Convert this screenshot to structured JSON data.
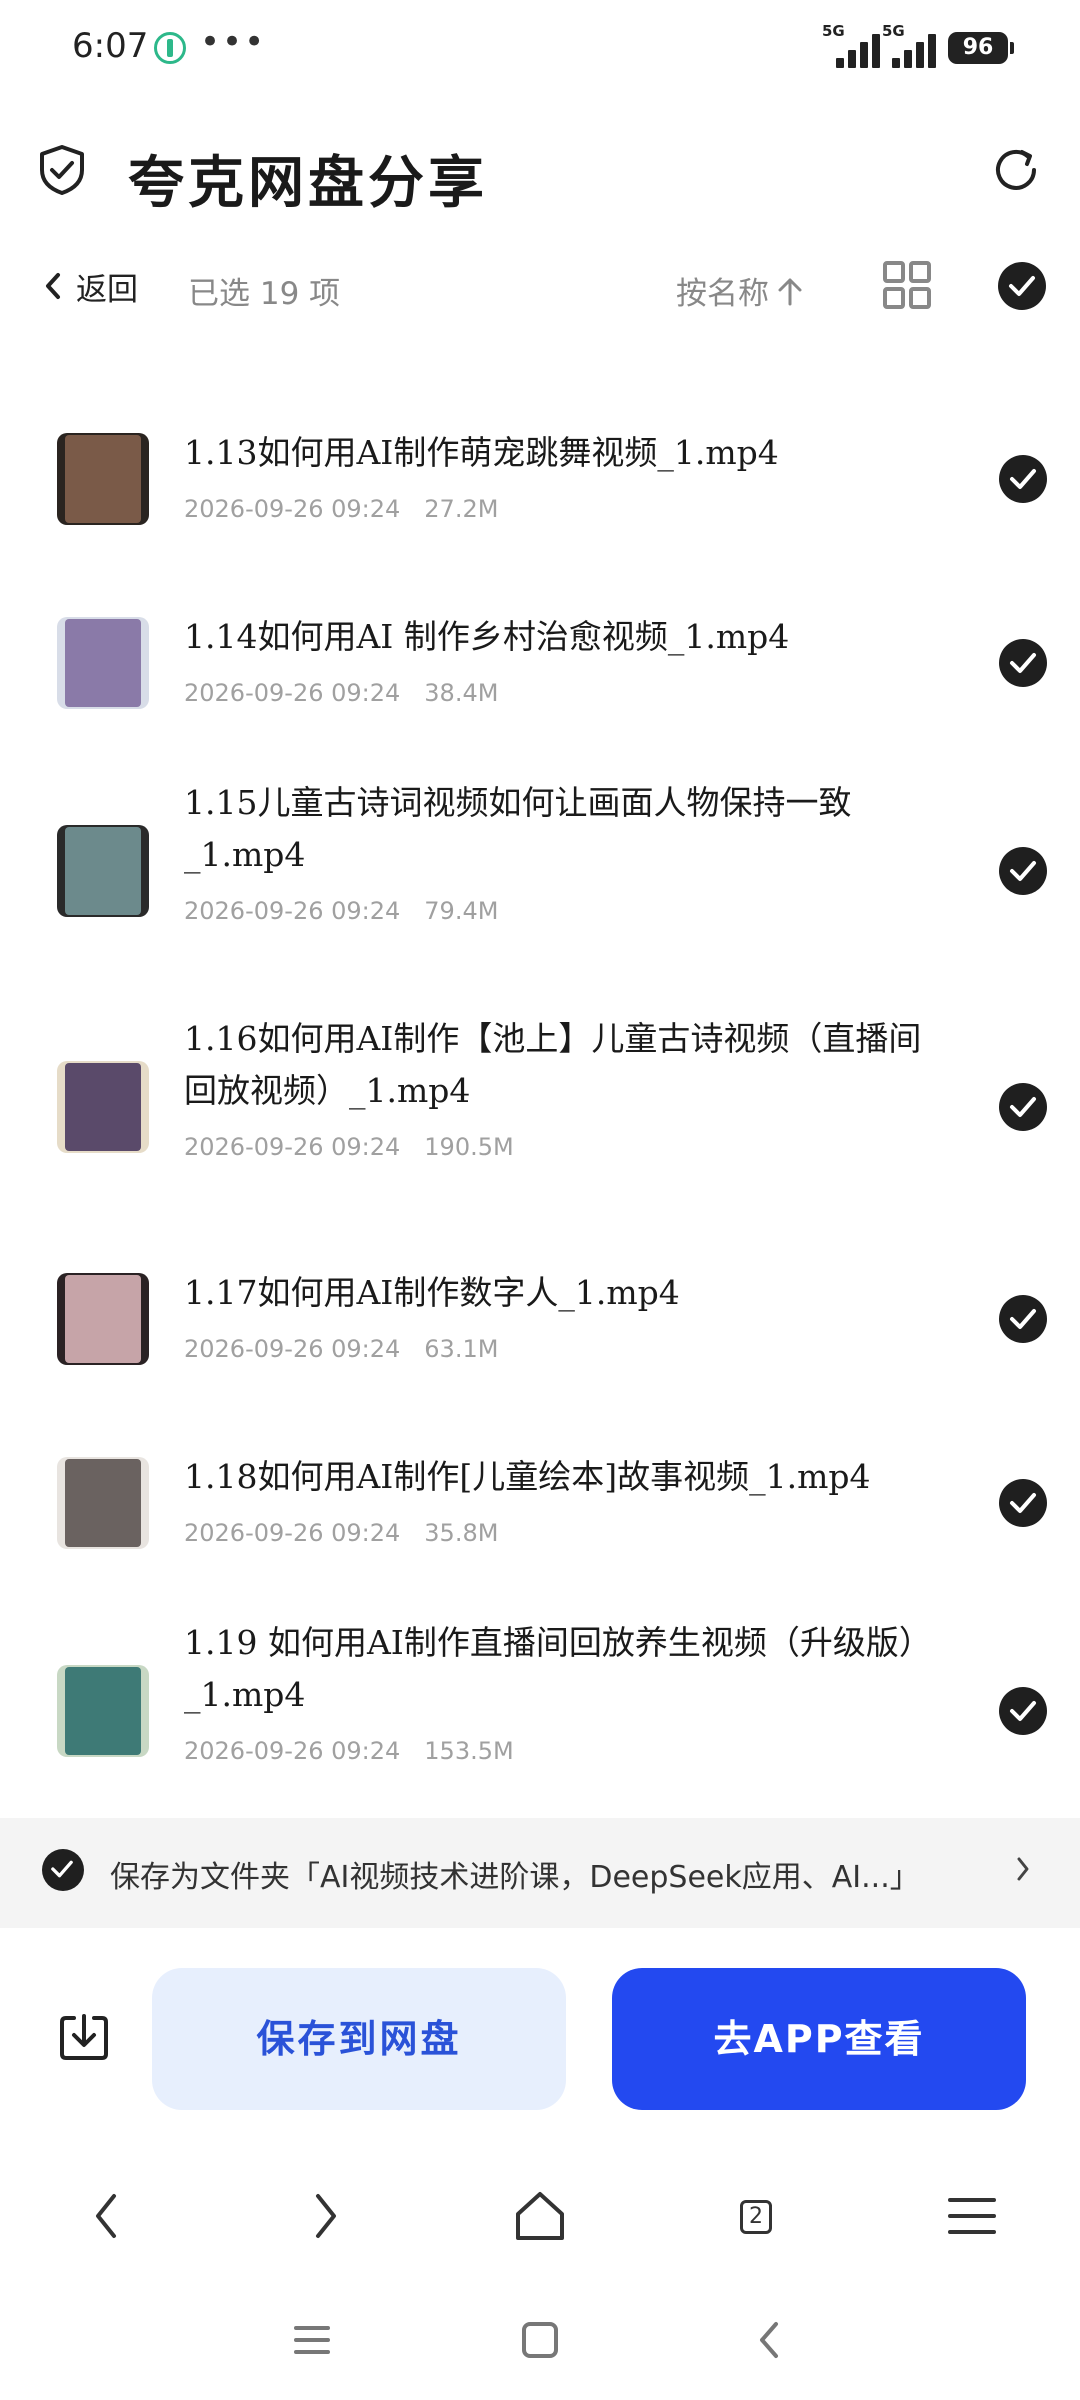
{
  "status": {
    "time": "6:07",
    "dots": "•••",
    "network_1": "5G",
    "network_2": "5G",
    "battery": "96"
  },
  "header": {
    "title": "夸克网盘分享"
  },
  "toolbar": {
    "back": "返回",
    "selected": "已选 19 项",
    "sort": "按名称"
  },
  "files": [
    {
      "name": "1.13如何用AI制作萌宠跳舞视频_1.mp4",
      "date": "2026-09-26 09:24",
      "size": "27.2M",
      "thumb": "#7a5a48"
    },
    {
      "name": "1.14如何用AI 制作乡村治愈视频_1.mp4",
      "date": "2026-09-26 09:24",
      "size": "38.4M",
      "thumb": "#8a7aa8"
    },
    {
      "name": "1.15儿童古诗词视频如何让画面人物保持一致_1.mp4",
      "date": "2026-09-26 09:24",
      "size": "79.4M",
      "thumb": "#6c8a8c"
    },
    {
      "name": "1.16如何用AI制作【池上】儿童古诗视频（直播间回放视频）_1.mp4",
      "date": "2026-09-26 09:24",
      "size": "190.5M",
      "thumb": "#5a4a6a"
    },
    {
      "name": "1.17如何用AI制作数字人_1.mp4",
      "date": "2026-09-26 09:24",
      "size": "63.1M",
      "thumb": "#c6a4a8"
    },
    {
      "name": "1.18如何用AI制作[儿童绘本]故事视频_1.mp4",
      "date": "2026-09-26 09:24",
      "size": "35.8M",
      "thumb": "#6a6260"
    },
    {
      "name": "1.19 如何用AI制作直播间回放养生视频（升级版）_1.mp4",
      "date": "2026-09-26 09:24",
      "size": "153.5M",
      "thumb": "#3e7a76"
    }
  ],
  "save_bar": {
    "text": "保存为文件夹「AI视频技术进阶课，DeepSeek应用、AI...」"
  },
  "actions": {
    "save": "保存到网盘",
    "open_app": "去APP查看"
  },
  "browser_nav": {
    "tabs_count": "2"
  },
  "colors": {
    "primary": "#2349f0",
    "primary_light": "#e7effd",
    "check": "#1f1f1f"
  }
}
